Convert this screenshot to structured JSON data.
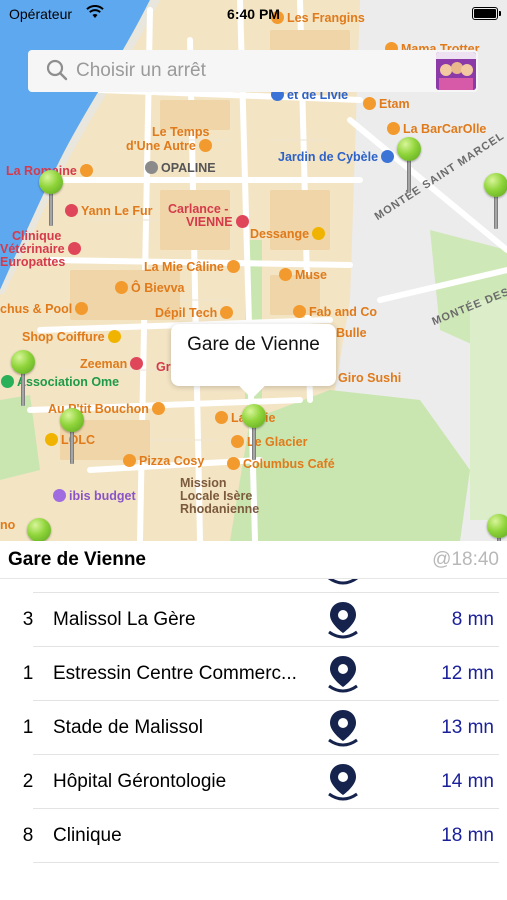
{
  "status_bar": {
    "carrier": "Opérateur",
    "time": "6:40 PM"
  },
  "search": {
    "placeholder": "Choisir un arrêt"
  },
  "map": {
    "callout": "Gare de Vienne",
    "labels": {
      "les_frangins": "Les Frangins",
      "mama_trotter": "Mama Trotter",
      "et_de_livie": "et de Livie",
      "etam": "Etam",
      "le_temps": "Le Temps",
      "dune_autre": "d'Une Autre",
      "la_barcarolle": "La BarCarOlle",
      "opaline": "OPALINE",
      "jardin_cybele": "Jardin de Cybèle",
      "la_romaine": "La Romaine",
      "yann_le_fur": "Yann Le Fur",
      "carlance": "Carlance -",
      "carlance_vienne": "VIENNE",
      "montee_saint_marcel": "MONTÉE SAINT MARCEL",
      "clinique_vet": "Clinique",
      "veterinaire": "Vétérinaire",
      "europattes": "Europattes",
      "dessange": "Dessange",
      "la_mie_caline": "La Mie Câline",
      "muse": "Muse",
      "o_bievva": "Ô Bievva",
      "montee_des_tu": "MONTÉE DES TU",
      "achus_pool": "chus & Pool",
      "depil_tech": "Dépil Tech",
      "fab_and_co": "Fab and Co",
      "shop_coiffure": "Shop Coiffure",
      "bulle": "Bulle",
      "zeeman": "Zeeman",
      "gr": "Gr",
      "giro_sushi": "Giro Sushi",
      "association_ome": "Association Ome",
      "au_ptit_bouchon": "Au P'tit Bouchon",
      "la_terie": "La    terie",
      "lolc": "LOLC",
      "le_glacier": "Le Glacier",
      "pizza_cosy": "Pizza Cosy",
      "columbus_cafe": "Columbus Café",
      "mission": "Mission",
      "locale_isere": "Locale Isère",
      "rhodanienne": "Rhodanienne",
      "ibis_budget": "ibis budget",
      "ono": "no"
    }
  },
  "panel": {
    "title": "Gare de Vienne",
    "updated": "@18:40",
    "rows": [
      {
        "line": "3",
        "stop": "Malissol La Gère",
        "eta": "8 mn"
      },
      {
        "line": "1",
        "stop": "Estressin Centre Commerc...",
        "eta": "12 mn"
      },
      {
        "line": "1",
        "stop": "Stade de Malissol",
        "eta": "13 mn"
      },
      {
        "line": "2",
        "stop": "Hôpital Gérontologie",
        "eta": "14 mn"
      },
      {
        "line": "8",
        "stop": "Clinique",
        "eta": "18 mn"
      }
    ]
  },
  "colors": {
    "accent": "#1a1f9a",
    "river": "#5ea8f0",
    "pin": "#8fd43a",
    "park": "#c9e6b0"
  }
}
